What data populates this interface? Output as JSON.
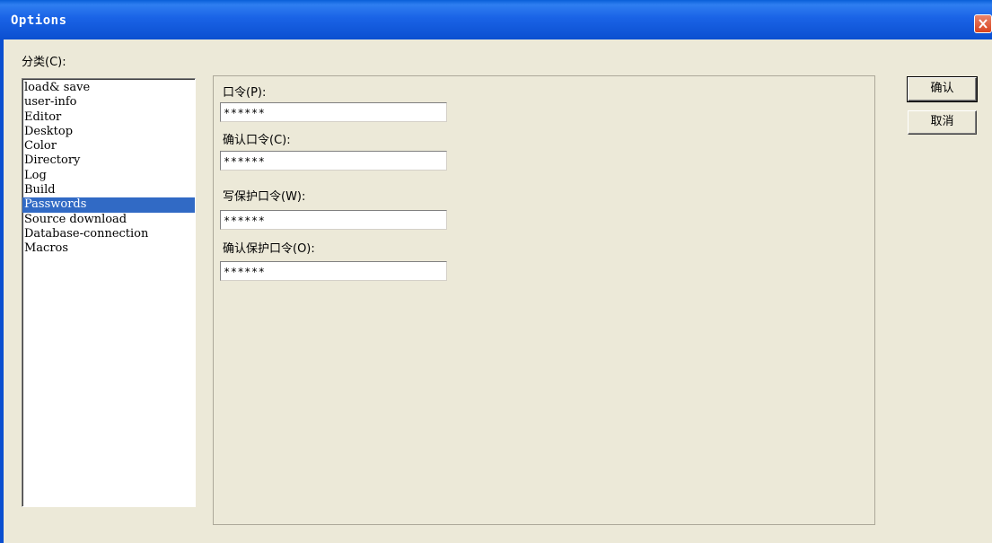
{
  "window": {
    "title": "Options"
  },
  "category_label": "分类(C):",
  "categories": [
    "load& save",
    "user-info",
    "Editor",
    "Desktop",
    "Color",
    "Directory",
    "Log",
    "Build",
    "Passwords",
    "Source download",
    "Database-connection",
    "Macros"
  ],
  "selected_category": "Passwords",
  "fields": {
    "password": {
      "label": "口令(P):",
      "value": "******"
    },
    "confirm_password": {
      "label": "确认口令(C):",
      "value": "******"
    },
    "write_protect_password": {
      "label": "写保护口令(W):",
      "value": "******"
    },
    "confirm_protect_password": {
      "label": "确认保护口令(O):",
      "value": "******"
    }
  },
  "buttons": {
    "ok": "确认",
    "cancel": "取消"
  },
  "icons": {
    "close": "close-icon"
  },
  "colors": {
    "title_bar": "#0b4fd0",
    "selection": "#316ac5",
    "close_button": "#d9431e"
  }
}
